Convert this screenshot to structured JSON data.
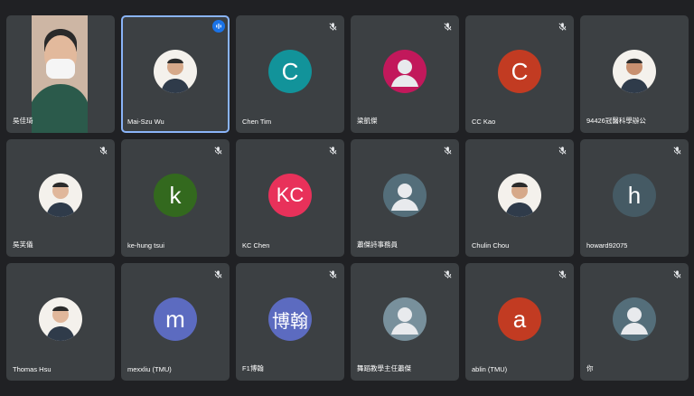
{
  "participants": [
    {
      "name": "吳佳琦",
      "mode": "video",
      "muted": false,
      "speaking": false
    },
    {
      "name": "Mai-Szu Wu",
      "mode": "photo",
      "muted": false,
      "speaking": true,
      "active": true
    },
    {
      "name": "Chen Tim",
      "mode": "letter",
      "initial": "C",
      "color": "#12939a",
      "muted": true
    },
    {
      "name": "梁凱傑",
      "mode": "generic",
      "color": "#c2185b",
      "muted": true
    },
    {
      "name": "CC Kao",
      "mode": "letter",
      "initial": "C",
      "color": "#c23b22",
      "muted": true
    },
    {
      "name": "94426冠醫科學辦公",
      "mode": "photo",
      "muted": false
    },
    {
      "name": "吳芙儀",
      "mode": "photo",
      "muted": true
    },
    {
      "name": "ke-hung tsui",
      "mode": "letter",
      "initial": "k",
      "color": "#33691e",
      "muted": true
    },
    {
      "name": "KC Chen",
      "mode": "letter",
      "initial": "KC",
      "color": "#e8315a",
      "muted": true
    },
    {
      "name": "蕭傑詩事務員",
      "mode": "generic",
      "color": "#546e7a",
      "muted": true
    },
    {
      "name": "Chulin Chou",
      "mode": "photo",
      "muted": true
    },
    {
      "name": "howard92075",
      "mode": "letter",
      "initial": "h",
      "color": "#455a64",
      "muted": true
    },
    {
      "name": "Thomas Hsu",
      "mode": "photo",
      "muted": false
    },
    {
      "name": "mexxliu (TMU)",
      "mode": "letter",
      "initial": "m",
      "color": "#5c6bc0",
      "muted": true
    },
    {
      "name": "F1博翰",
      "mode": "letter",
      "initial": "博翰",
      "color": "#5c6bc0",
      "muted": true
    },
    {
      "name": "舞蹈教學主任蕭傑",
      "mode": "generic",
      "color": "#78909c",
      "muted": true
    },
    {
      "name": "ablin (TMU)",
      "mode": "letter",
      "initial": "a",
      "color": "#c23b22",
      "muted": true
    },
    {
      "name": "你",
      "mode": "generic",
      "color": "#546e7a",
      "muted": true
    }
  ]
}
